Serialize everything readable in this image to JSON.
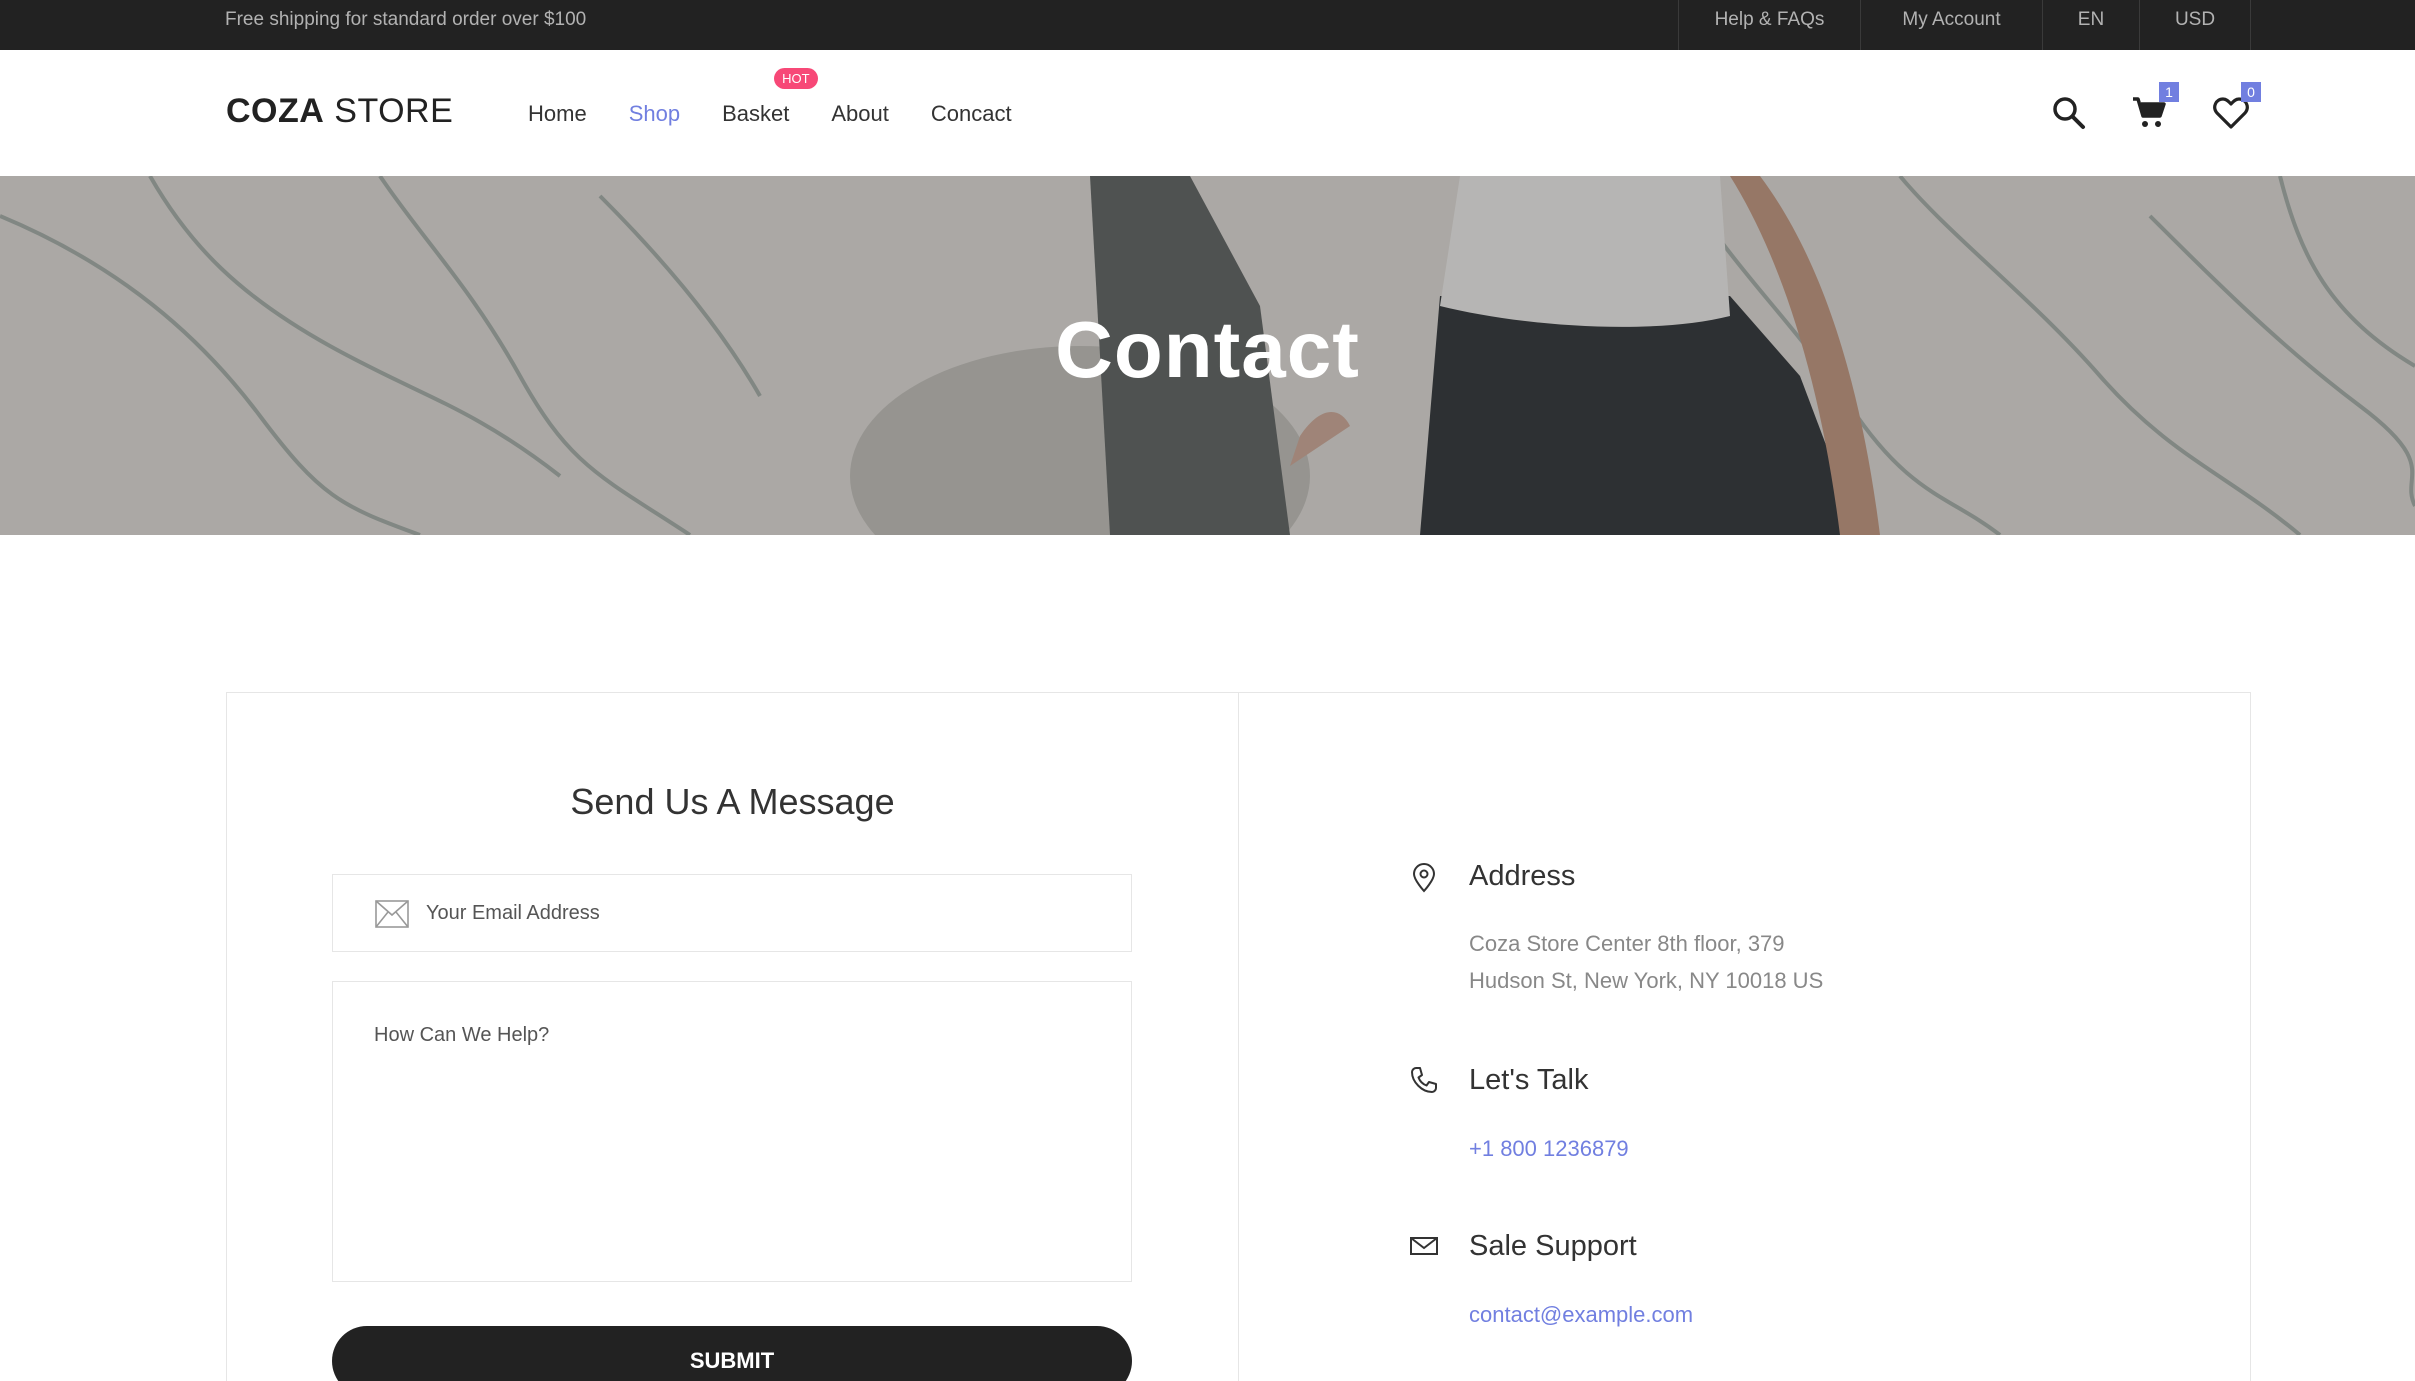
{
  "topbar": {
    "shipping": "Free shipping for standard order over $100",
    "help": "Help & FAQs",
    "account": "My Account",
    "language": "EN",
    "currency": "USD"
  },
  "header": {
    "logo_bold": "COZA",
    "logo_light": " STORE",
    "nav": [
      {
        "label": "Home"
      },
      {
        "label": "Shop"
      },
      {
        "label": "Basket"
      },
      {
        "label": "About"
      },
      {
        "label": "Concact"
      }
    ],
    "hot_badge": "HOT",
    "active_nav": "Shop",
    "cart_count": "1",
    "wishlist_count": "0",
    "icons": [
      "search-icon",
      "cart-icon",
      "heart-icon"
    ]
  },
  "hero": {
    "title": "Contact"
  },
  "form": {
    "title": "Send Us A Message",
    "email_placeholder": "Your Email Address",
    "message_placeholder": "How Can We Help?",
    "submit_label": "SUBMIT"
  },
  "contact_info": {
    "address_title": "Address",
    "address_line1": "Coza Store Center 8th floor, 379",
    "address_line2": "Hudson St, New York, NY 10018 US",
    "talk_title": "Let's Talk",
    "phone": "+1 800 1236879",
    "support_title": "Sale Support",
    "email": "contact@example.com"
  },
  "colors": {
    "accent": "#717fe0",
    "dark": "#222222",
    "hot": "#f74877"
  }
}
